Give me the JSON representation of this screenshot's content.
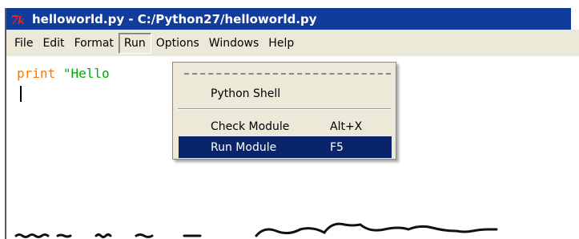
{
  "window": {
    "title": "helloworld.py - C:/Python27/helloworld.py",
    "icon": "tk-icon"
  },
  "menubar": {
    "items": [
      {
        "label": "File"
      },
      {
        "label": "Edit"
      },
      {
        "label": "Format"
      },
      {
        "label": "Run",
        "active": true
      },
      {
        "label": "Options"
      },
      {
        "label": "Windows"
      },
      {
        "label": "Help"
      }
    ]
  },
  "editor": {
    "keyword": "print",
    "string": "\"Hello"
  },
  "run_menu": {
    "items": [
      {
        "label": "Python Shell",
        "accel": ""
      },
      {
        "label": "Check Module",
        "accel": "Alt+X"
      },
      {
        "label": "Run Module",
        "accel": "F5",
        "selected": true
      }
    ]
  },
  "colors": {
    "titlebar": "#123c9a",
    "menubar": "#ece9d8",
    "selection": "#0a2469",
    "keyword": "#ff7700",
    "string": "#00aa00"
  }
}
